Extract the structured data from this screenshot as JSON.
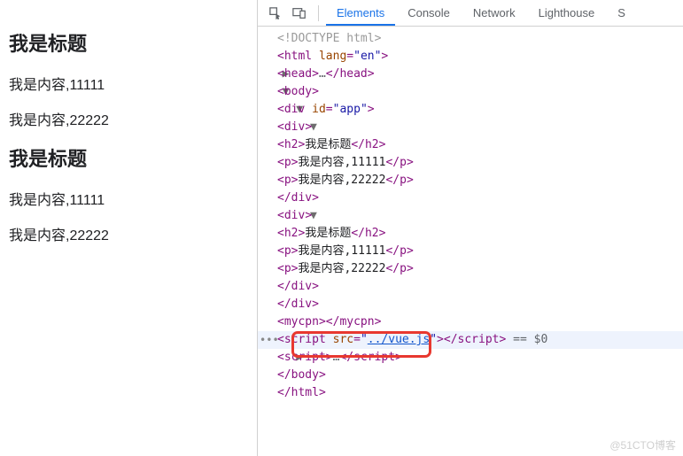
{
  "page": {
    "blocks": [
      {
        "title": "我是标题",
        "lines": [
          "我是内容,11111",
          "我是内容,22222"
        ]
      },
      {
        "title": "我是标题",
        "lines": [
          "我是内容,11111",
          "我是内容,22222"
        ]
      }
    ]
  },
  "devtools": {
    "tabs": [
      "Elements",
      "Console",
      "Network",
      "Lighthouse",
      "S"
    ],
    "activeTab": 0,
    "dom": {
      "doctype": "<!DOCTYPE html>",
      "htmlOpen": {
        "tag": "html",
        "attr": "lang",
        "val": "en"
      },
      "headCollapsed": {
        "open": "head",
        "dots": "…",
        "close": "head"
      },
      "bodyOpen": "body",
      "appDiv": {
        "tag": "div",
        "attr": "id",
        "val": "app"
      },
      "innerDivs": [
        {
          "open": "div",
          "children": [
            {
              "tag": "h2",
              "text": "我是标题"
            },
            {
              "tag": "p",
              "text": "我是内容,11111"
            },
            {
              "tag": "p",
              "text": "我是内容,22222"
            }
          ],
          "close": "div"
        },
        {
          "open": "div",
          "children": [
            {
              "tag": "h2",
              "text": "我是标题"
            },
            {
              "tag": "p",
              "text": "我是内容,11111"
            },
            {
              "tag": "p",
              "text": "我是内容,22222"
            }
          ],
          "close": "div"
        }
      ],
      "appClose": "div",
      "customEl": "mycpn",
      "scriptSrc": {
        "tag": "script",
        "attr": "src",
        "val": "../vue.js",
        "suffix": " == $0"
      },
      "scriptCollapsed": {
        "open": "script",
        "dots": "…",
        "close": "script"
      },
      "bodyClose": "body",
      "htmlClose": "html"
    }
  },
  "watermark": "@51CTO博客"
}
